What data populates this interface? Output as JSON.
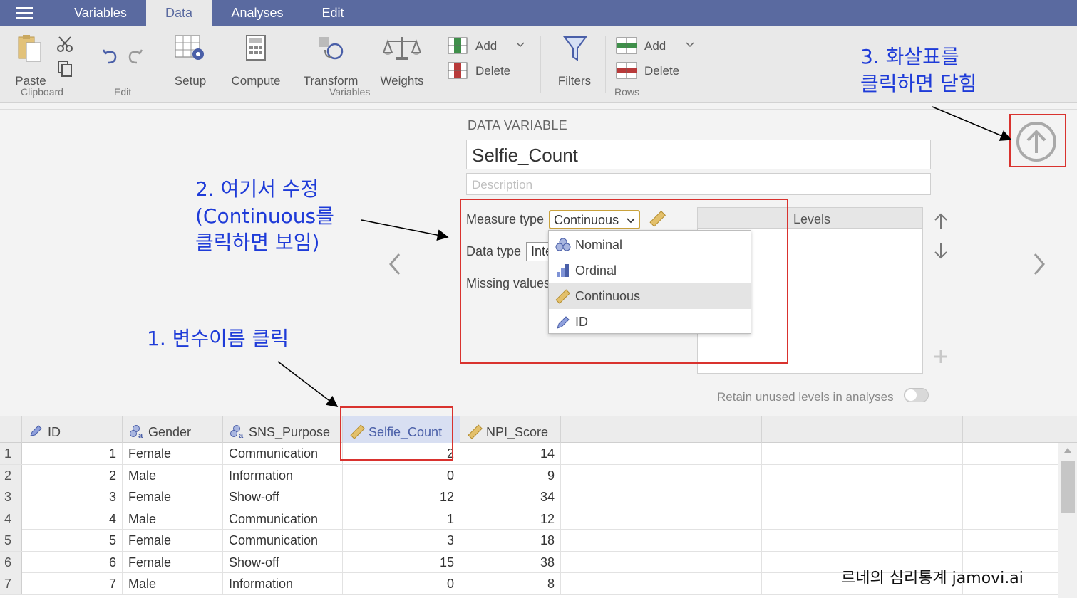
{
  "menu": {
    "tabs": [
      {
        "label": "Variables"
      },
      {
        "label": "Data"
      },
      {
        "label": "Analyses"
      },
      {
        "label": "Edit"
      }
    ]
  },
  "ribbon": {
    "paste": "Paste",
    "clipboard_group": "Clipboard",
    "edit_group": "Edit",
    "setup": "Setup",
    "compute": "Compute",
    "transform": "Transform",
    "weights": "Weights",
    "var_add": "Add",
    "var_delete": "Delete",
    "variables_group": "Variables",
    "filters": "Filters",
    "row_add": "Add",
    "row_delete": "Delete",
    "rows_group": "Rows"
  },
  "editor": {
    "header": "DATA VARIABLE",
    "name_value": "Selfie_Count",
    "description_placeholder": "Description",
    "measure_type_label": "Measure type",
    "measure_type_value": "Continuous",
    "data_type_label": "Data type",
    "data_type_value": "Inte",
    "missing_values_label": "Missing values",
    "levels_header": "Levels",
    "retain_label": "Retain unused levels in analyses",
    "retain_on": false
  },
  "dropdown": {
    "options": [
      {
        "label": "Nominal",
        "icon": "nominal-icon"
      },
      {
        "label": "Ordinal",
        "icon": "ordinal-icon"
      },
      {
        "label": "Continuous",
        "icon": "continuous-icon",
        "selected": true
      },
      {
        "label": "ID",
        "icon": "id-icon"
      }
    ]
  },
  "annotations": {
    "step1": "1. 변수이름 클릭",
    "step2_line1": "2. 여기서 수정",
    "step2_line2": "(Continuous를",
    "step2_line3": "클릭하면 보임)",
    "step3_line1": "3. 화살표를",
    "step3_line2": "클릭하면 닫힘",
    "watermark": "르네의 심리통계 jamovi.ai"
  },
  "grid": {
    "columns": [
      {
        "name": "ID",
        "type": "id"
      },
      {
        "name": "Gender",
        "type": "nominal-text"
      },
      {
        "name": "SNS_Purpose",
        "type": "nominal-text"
      },
      {
        "name": "Selfie_Count",
        "type": "continuous",
        "selected": true
      },
      {
        "name": "NPI_Score",
        "type": "continuous"
      }
    ],
    "rows": [
      {
        "n": "1",
        "id": "1",
        "gender": "Female",
        "purpose": "Communication",
        "selfie": "2",
        "npi": "14"
      },
      {
        "n": "2",
        "id": "2",
        "gender": "Male",
        "purpose": "Information",
        "selfie": "0",
        "npi": "9"
      },
      {
        "n": "3",
        "id": "3",
        "gender": "Female",
        "purpose": "Show-off",
        "selfie": "12",
        "npi": "34"
      },
      {
        "n": "4",
        "id": "4",
        "gender": "Male",
        "purpose": "Communication",
        "selfie": "1",
        "npi": "12"
      },
      {
        "n": "5",
        "id": "5",
        "gender": "Female",
        "purpose": "Communication",
        "selfie": "3",
        "npi": "18"
      },
      {
        "n": "6",
        "id": "6",
        "gender": "Female",
        "purpose": "Show-off",
        "selfie": "15",
        "npi": "38"
      },
      {
        "n": "7",
        "id": "7",
        "gender": "Male",
        "purpose": "Information",
        "selfie": "0",
        "npi": "8"
      }
    ]
  },
  "colors": {
    "menubar": "#5a6aa0",
    "annotation": "#1e3bd8",
    "highlight_box": "#d9322e",
    "selected_column": "#d8dff2"
  }
}
